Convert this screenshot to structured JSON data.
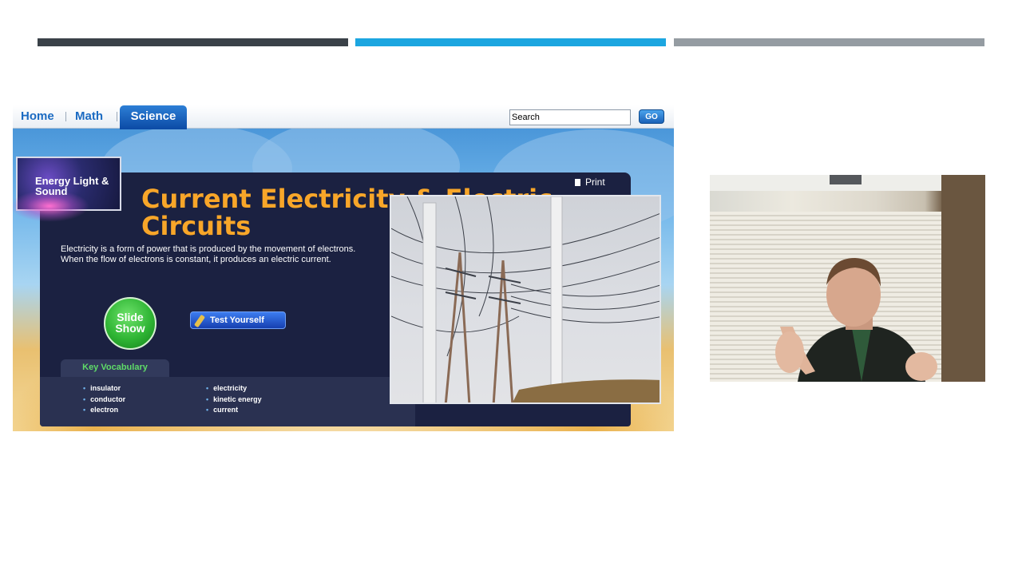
{
  "nav": {
    "home": "Home",
    "math": "Math",
    "science": "Science",
    "search_placeholder": "Search",
    "go": "GO"
  },
  "topic_badge": "Energy Light & Sound",
  "page": {
    "title": "Current Electricity & Electric Circuits",
    "print": "Print",
    "description": "Electricity is a form of power that is produced by the movement of electrons. When the flow of electrons is constant, it produces an electric current.",
    "slide_show": "Slide Show",
    "test_yourself": "Test Yourself"
  },
  "vocabulary": {
    "heading": "Key Vocabulary",
    "col1": [
      "insulator",
      "conductor",
      "electron"
    ],
    "col2": [
      "electricity",
      "kinetic energy",
      "current"
    ]
  },
  "colors": {
    "accent_bar_1": "#3a4148",
    "accent_bar_2": "#1ca6e0",
    "accent_bar_3": "#959ca2",
    "title_orange": "#f8a629",
    "panel_navy": "#1b2141",
    "vocab_green": "#5fdc68"
  }
}
